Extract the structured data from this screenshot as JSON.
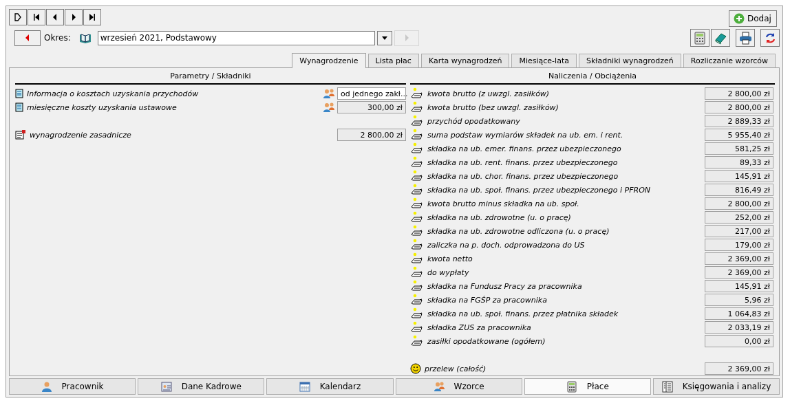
{
  "toolbar": {
    "nav_buttons": [
      {
        "kind": "new"
      },
      {
        "kind": "first"
      },
      {
        "kind": "prev"
      },
      {
        "kind": "next"
      },
      {
        "kind": "last"
      }
    ],
    "add_button": "Dodaj"
  },
  "period": {
    "label": "Okres:",
    "value": "wrzesień 2021, Podstawowy",
    "next_disabled": true
  },
  "tabs": [
    {
      "label": "Wynagrodzenie",
      "selected": true
    },
    {
      "label": "Lista płac",
      "selected": false
    },
    {
      "label": "Karta wynagrodzeń",
      "selected": false
    },
    {
      "label": "Miesiące-lata",
      "selected": false
    },
    {
      "label": "Składniki wynagrodzeń",
      "selected": false
    },
    {
      "label": "Rozliczanie wzorców",
      "selected": false
    }
  ],
  "left": {
    "heading": "Parametry / Składniki",
    "items": [
      {
        "kind": "parameter",
        "label": "Informacja o kosztach uzyskania przychodów",
        "field": {
          "kind": "text",
          "value": "od jednego zakł..."
        }
      },
      {
        "kind": "parameter",
        "label": "miesięczne koszty uzyskania ustawowe",
        "field": {
          "kind": "amount",
          "value": "300,00 zł"
        }
      },
      {
        "kind": "component",
        "label": "wynagrodzenie zasadnicze",
        "field": {
          "kind": "amount",
          "value": "2 800,00 zł"
        }
      }
    ]
  },
  "right": {
    "heading": "Naliczenia / Obciążenia",
    "items": [
      {
        "kind": "charge",
        "label": "kwota brutto (z uwzgl. zasiłków)",
        "value": "2 800,00 zł"
      },
      {
        "kind": "charge",
        "label": "kwota brutto (bez uwzgl. zasiłków)",
        "value": "2 800,00 zł"
      },
      {
        "kind": "charge",
        "label": "przychód opodatkowany",
        "value": "2 889,33 zł"
      },
      {
        "kind": "charge",
        "label": "suma podstaw wymiarów składek na ub. em. i rent.",
        "value": "5 955,40 zł"
      },
      {
        "kind": "charge",
        "label": "składka na ub. emer. finans. przez ubezpieczonego",
        "value": "581,25 zł"
      },
      {
        "kind": "charge",
        "label": "składka na ub. rent. finans. przez ubezpieczonego",
        "value": "89,33 zł"
      },
      {
        "kind": "charge",
        "label": "składka na ub. chor. finans. przez ubezpieczonego",
        "value": "145,91 zł"
      },
      {
        "kind": "charge",
        "label": "składka na ub. społ. finans. przez ubezpieczonego i PFRON",
        "value": "816,49 zł"
      },
      {
        "kind": "charge",
        "label": "kwota brutto minus składka na ub. społ.",
        "value": "2 800,00 zł"
      },
      {
        "kind": "charge",
        "label": "składka na ub. zdrowotne (u. o pracę)",
        "value": "252,00 zł"
      },
      {
        "kind": "charge",
        "label": "składka na ub. zdrowotne odliczona (u. o pracę)",
        "value": "217,00 zł"
      },
      {
        "kind": "charge",
        "label": "zaliczka na p. doch. odprowadzona do US",
        "value": "179,00 zł"
      },
      {
        "kind": "charge",
        "label": "kwota netto",
        "value": "2 369,00 zł"
      },
      {
        "kind": "charge",
        "label": "do wypłaty",
        "value": "2 369,00 zł"
      },
      {
        "kind": "charge",
        "label": "składka na Fundusz Pracy za pracownika",
        "value": "145,91 zł"
      },
      {
        "kind": "charge",
        "label": "składka na FGŚP za pracownika",
        "value": "5,96 zł"
      },
      {
        "kind": "charge",
        "label": "składka na ub. społ. finans. przez płatnika składek",
        "value": "1 064,83 zł"
      },
      {
        "kind": "charge",
        "label": "składka ZUS za pracownika",
        "value": "2 033,19 zł"
      },
      {
        "kind": "charge",
        "label": "zasiłki opodatkowane (ogółem)",
        "value": "0,00 zł"
      },
      {
        "kind": "transfer",
        "label": "przelew (całość)",
        "value": "2 369,00 zł"
      }
    ]
  },
  "bottom_tabs": [
    {
      "label": "Pracownik",
      "kind": "person",
      "selected": false
    },
    {
      "label": "Dane Kadrowe",
      "kind": "card",
      "selected": false
    },
    {
      "label": "Kalendarz",
      "kind": "calendar",
      "selected": false
    },
    {
      "label": "Wzorce",
      "kind": "people",
      "selected": false
    },
    {
      "label": "Płace",
      "kind": "calculator",
      "selected": true
    },
    {
      "label": "Księgowania i analizy",
      "kind": "ledger",
      "selected": false
    }
  ]
}
